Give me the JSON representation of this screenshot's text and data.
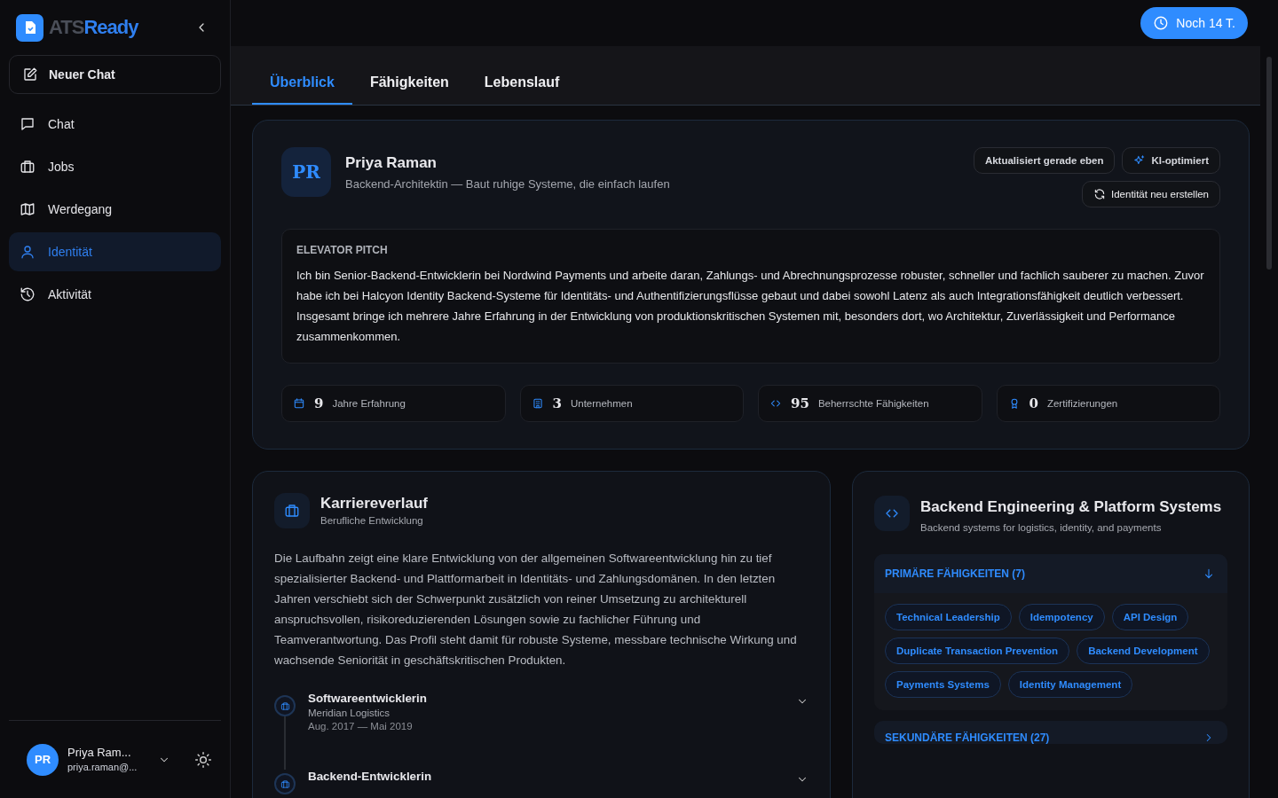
{
  "sidebar": {
    "logo": {
      "part_1": "ATS",
      "part_2": "Ready"
    },
    "new_chat": "Neuer Chat",
    "items": [
      {
        "label": "Chat",
        "selected": false
      },
      {
        "label": "Jobs",
        "selected": false
      },
      {
        "label": "Werdegang",
        "selected": false
      },
      {
        "label": "Identität",
        "selected": true
      },
      {
        "label": "Aktivität",
        "selected": false
      }
    ],
    "user": {
      "initials": "PR",
      "name": "Priya Ram...",
      "email": "priya.raman@..."
    }
  },
  "trial_badge": "Noch 14 T.",
  "tabs": [
    {
      "label": "Überblick",
      "selected": true
    },
    {
      "label": "Fähigkeiten",
      "selected": false
    },
    {
      "label": "Lebenslauf",
      "selected": false
    }
  ],
  "profile": {
    "initials": "PR",
    "name": "Priya Raman",
    "headline": "Backend-Architektin — Baut ruhige Systeme, die einfach laufen",
    "badges": [
      "Aktualisiert gerade eben",
      "KI-optimiert"
    ],
    "regenerate": "Identität neu erstellen",
    "pitch_label": "ELEVATOR PITCH",
    "pitch": "Ich bin Senior-Backend-Entwicklerin bei Nordwind Payments und arbeite daran, Zahlungs- und Abrechnungsprozesse robuster, schneller und fachlich sauberer zu machen. Zuvor habe ich bei Halcyon Identity Backend-Systeme für Identitäts- und Authentifizierungsflüsse gebaut und dabei sowohl Latenz als auch Integrationsfähigkeit deutlich verbessert. Insgesamt bringe ich mehrere Jahre Erfahrung in der Entwicklung von produktionskritischen Systemen mit, besonders dort, wo Architektur, Zuverlässigkeit und Performance zusammenkommen.",
    "stats": [
      {
        "value": "9",
        "label": "Jahre Erfahrung"
      },
      {
        "value": "3",
        "label": "Unternehmen"
      },
      {
        "value": "95",
        "label": "Beherrschte Fähigkeiten"
      },
      {
        "value": "0",
        "label": "Zertifizierungen"
      }
    ]
  },
  "career": {
    "title": "Karriereverlauf",
    "subtitle": "Berufliche Entwicklung",
    "summary": "Die Laufbahn zeigt eine klare Entwicklung von der allgemeinen Softwareentwicklung hin zu tief spezialisierter Backend- und Plattformarbeit in Identitäts- und Zahlungsdomänen. In den letzten Jahren verschiebt sich der Schwerpunkt zusätzlich von reiner Umsetzung zu architekturell anspruchsvollen, risikoreduzierenden Lösungen sowie zu fachlicher Führung und Teamverantwortung. Das Profil steht damit für robuste Systeme, messbare technische Wirkung und wachsende Seniorität in geschäftskritischen Produkten.",
    "roles": [
      {
        "title": "Softwareentwicklerin",
        "company": "Meridian Logistics",
        "period": "Aug. 2017 — Mai 2019",
        "expanded": false
      },
      {
        "title": "Backend-Entwicklerin",
        "expanded": false
      }
    ]
  },
  "skills_card": {
    "title": "Backend Engineering & Platform Systems",
    "subtitle": "Backend systems for logistics, identity, and payments",
    "groups": [
      {
        "label": "PRIMÄRE FÄHIGKEITEN (7)",
        "expanded": true,
        "skills": [
          "Technical Leadership",
          "Idempotency",
          "API Design",
          "Duplicate Transaction Prevention",
          "Backend Development",
          "Payments Systems",
          "Identity Management"
        ]
      },
      {
        "label": "SEKUNDÄRE FÄHIGKEITEN (27)",
        "expanded": false
      }
    ]
  }
}
